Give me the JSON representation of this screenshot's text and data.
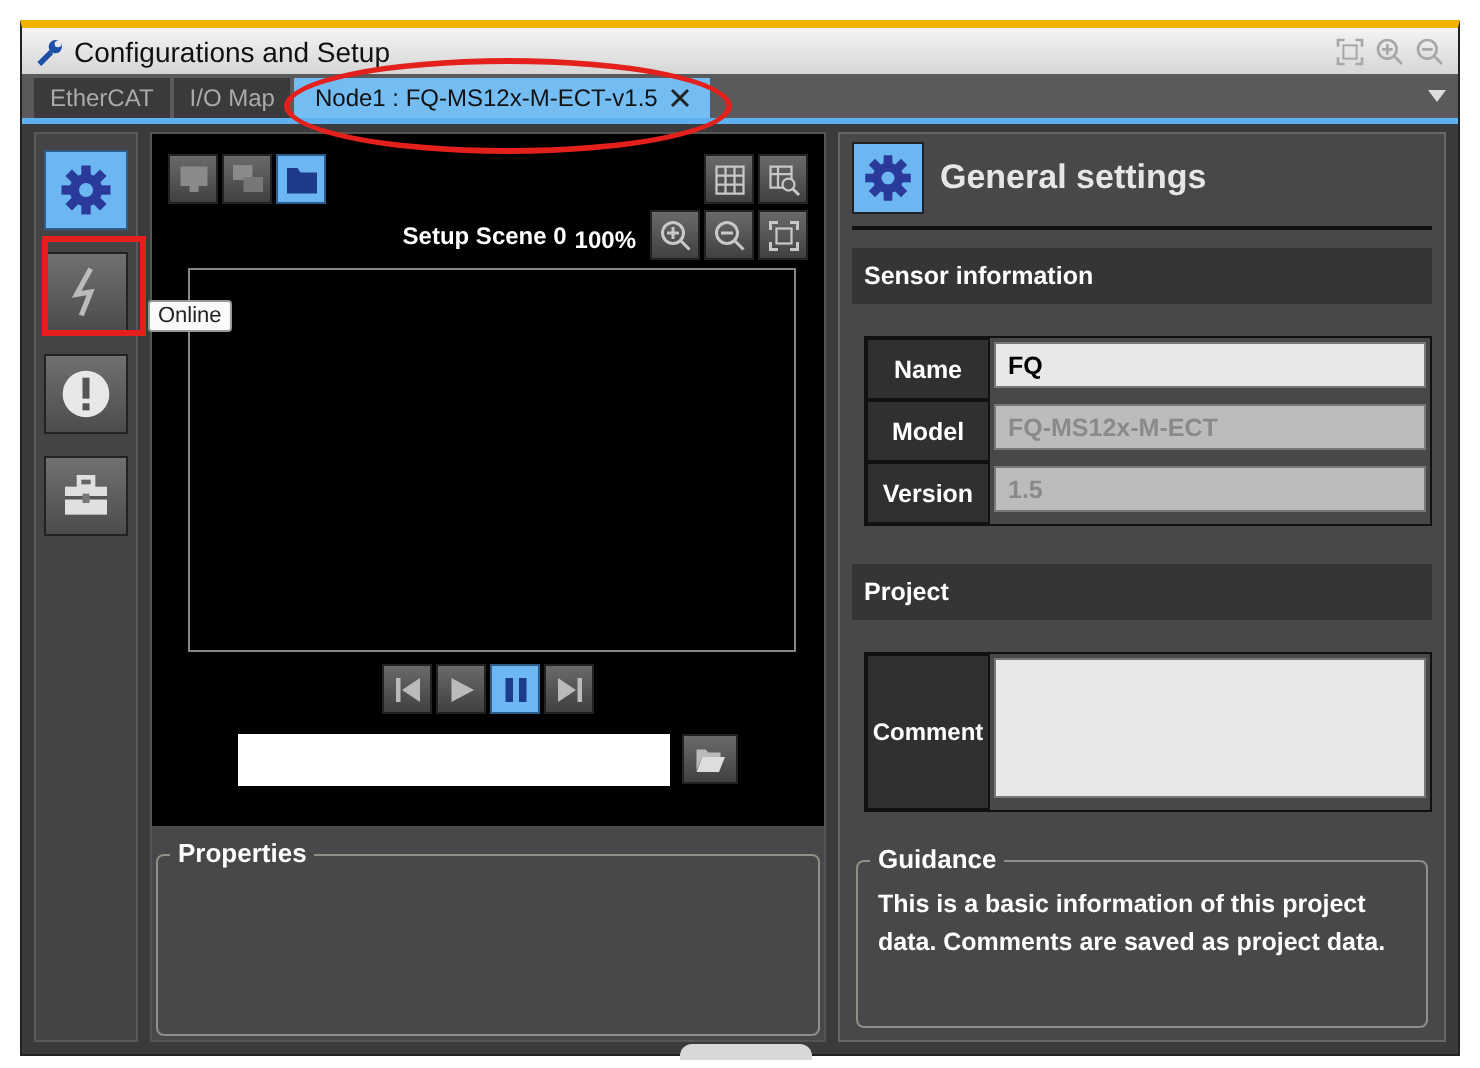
{
  "window": {
    "title": "Configurations and Setup"
  },
  "title_tools": [
    {
      "kind": "fit"
    },
    {
      "kind": "zoom-in"
    },
    {
      "kind": "zoom-out"
    }
  ],
  "tabs": [
    {
      "label": "EtherCAT",
      "selected": false,
      "closable": false
    },
    {
      "label": "I/O Map",
      "selected": false,
      "closable": false
    },
    {
      "label": "Node1 : FQ-MS12x-M-ECT-v1.5",
      "selected": true,
      "closable": true
    }
  ],
  "sidebar": {
    "items": [
      {
        "kind": "settings",
        "selected": true
      },
      {
        "kind": "online",
        "selected": false
      },
      {
        "kind": "warning",
        "selected": false
      },
      {
        "kind": "toolbox",
        "selected": false
      }
    ]
  },
  "tooltip": {
    "text": "Online"
  },
  "viewer": {
    "tools_left": [
      {
        "kind": "monitor",
        "selected": false
      },
      {
        "kind": "monitors",
        "selected": false
      },
      {
        "kind": "folder",
        "selected": true
      }
    ],
    "tools_right": [
      {
        "kind": "grid"
      },
      {
        "kind": "grid-zoom"
      }
    ],
    "scene": "Setup Scene 0",
    "zoom": "100%",
    "zoom_tools": [
      {
        "kind": "zoom-in"
      },
      {
        "kind": "zoom-out"
      },
      {
        "kind": "fit"
      }
    ],
    "playback": [
      {
        "kind": "first",
        "selected": false
      },
      {
        "kind": "play",
        "selected": false
      },
      {
        "kind": "pause",
        "selected": true
      },
      {
        "kind": "last",
        "selected": false
      }
    ]
  },
  "properties": {
    "title": "Properties"
  },
  "settings": {
    "title": "General settings",
    "sections": [
      {
        "title": "Sensor information",
        "fields": [
          {
            "kind": "text",
            "label": "Name",
            "value": "FQ",
            "disabled": false
          },
          {
            "kind": "text",
            "label": "Model",
            "value": "FQ-MS12x-M-ECT",
            "disabled": true
          },
          {
            "kind": "text",
            "label": "Version",
            "value": "1.5",
            "disabled": true
          }
        ]
      },
      {
        "title": "Project",
        "fields": [
          {
            "kind": "textarea",
            "label": "Comment",
            "disabled": false
          }
        ]
      }
    ]
  },
  "guidance": {
    "title": "Guidance",
    "text": "This is a basic information of this project data. Comments are saved as project data."
  },
  "annotations": [
    {
      "kind": "rectangle"
    },
    {
      "kind": "ellipse"
    }
  ]
}
